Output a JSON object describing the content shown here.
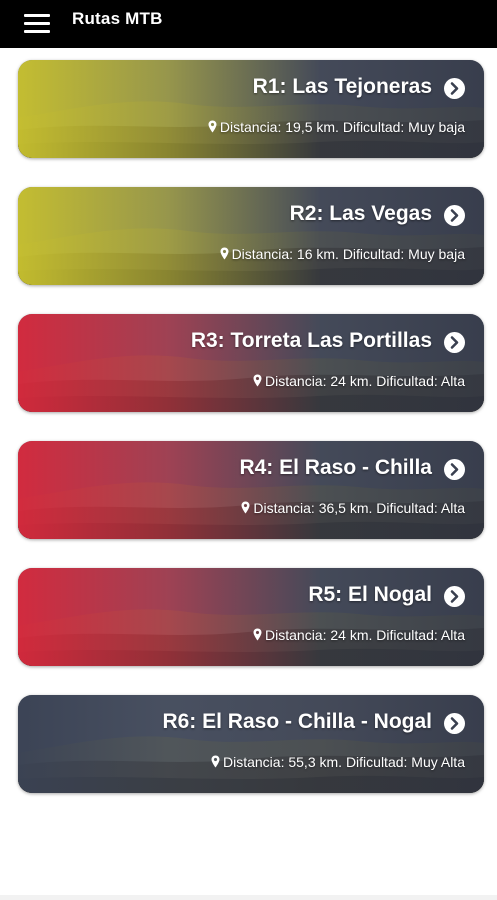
{
  "app_bar": {
    "title": "Rutas MTB",
    "menu_icon": "hamburger-menu-icon"
  },
  "routes": [
    {
      "title": "R1: Las Tejoneras",
      "info": "Distancia: 19,5 km. Dificultad: Muy baja",
      "color": "#c9c22e"
    },
    {
      "title": "R2: Las Vegas",
      "info": "Distancia: 16 km. Dificultad: Muy baja",
      "color": "#c9c22e"
    },
    {
      "title": "R3: Torreta Las Portillas",
      "info": "Distancia: 24 km. Dificultad: Alta",
      "color": "#d8283c"
    },
    {
      "title": "R4: El Raso - Chilla",
      "info": "Distancia: 36,5 km. Dificultad: Alta",
      "color": "#d8283c"
    },
    {
      "title": "R5: El Nogal",
      "info": "Distancia: 24 km. Dificultad: Alta",
      "color": "#d8283c"
    },
    {
      "title": "R6: El Raso - Chilla - Nogal",
      "info": "Distancia: 55,3 km. Dificultad: Muy Alta",
      "color": "#3a4254"
    }
  ],
  "icons": {
    "card_action": "arrow-circle-right-icon",
    "location": "map-marker-icon"
  }
}
